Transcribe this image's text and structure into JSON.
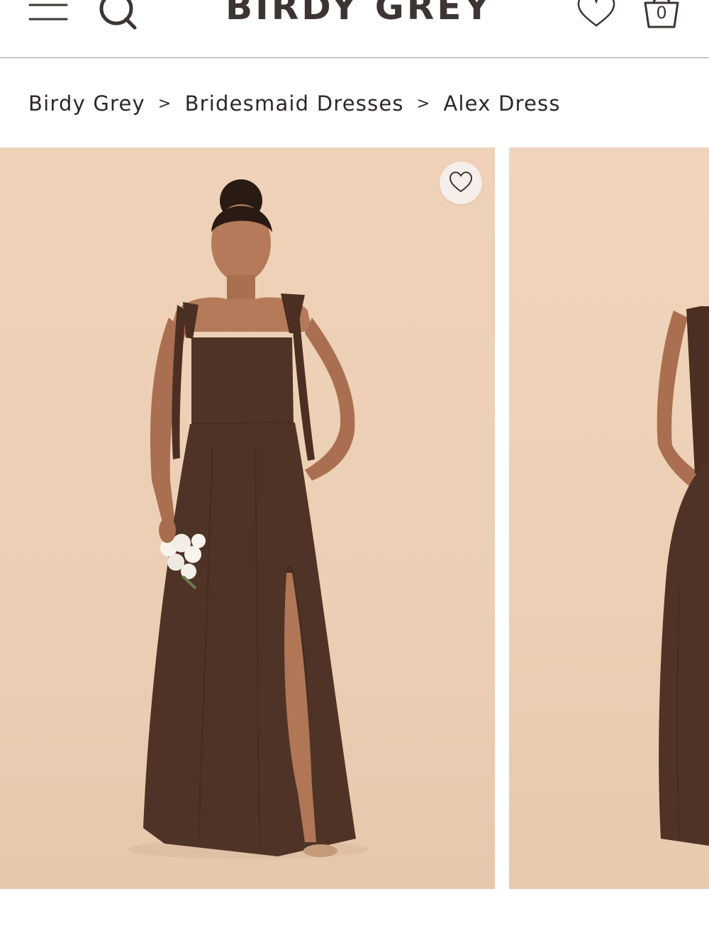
{
  "header": {
    "logo": "BIRDY GREY",
    "menu_icon": "hamburger-menu-icon",
    "search_icon": "magnifier-icon",
    "wishlist_icon": "heart-outline-icon",
    "cart_icon": "shopping-bag-icon",
    "cart_count": "0"
  },
  "breadcrumb": {
    "items": [
      "Birdy Grey",
      "Bridesmaid Dresses",
      "Alex Dress"
    ],
    "separator": ">"
  },
  "gallery": {
    "favorite_icon": "heart-outline-icon",
    "slides": [
      {
        "subject": "model-in-brown-dress-front"
      },
      {
        "subject": "model-in-brown-dress-partial"
      }
    ]
  },
  "colors": {
    "text": "#3a3330",
    "photo_background": "#ecd0b6",
    "dress": "#4e3326",
    "favorite_button_bg": "#f6efe9",
    "header_border": "#9a9593"
  }
}
